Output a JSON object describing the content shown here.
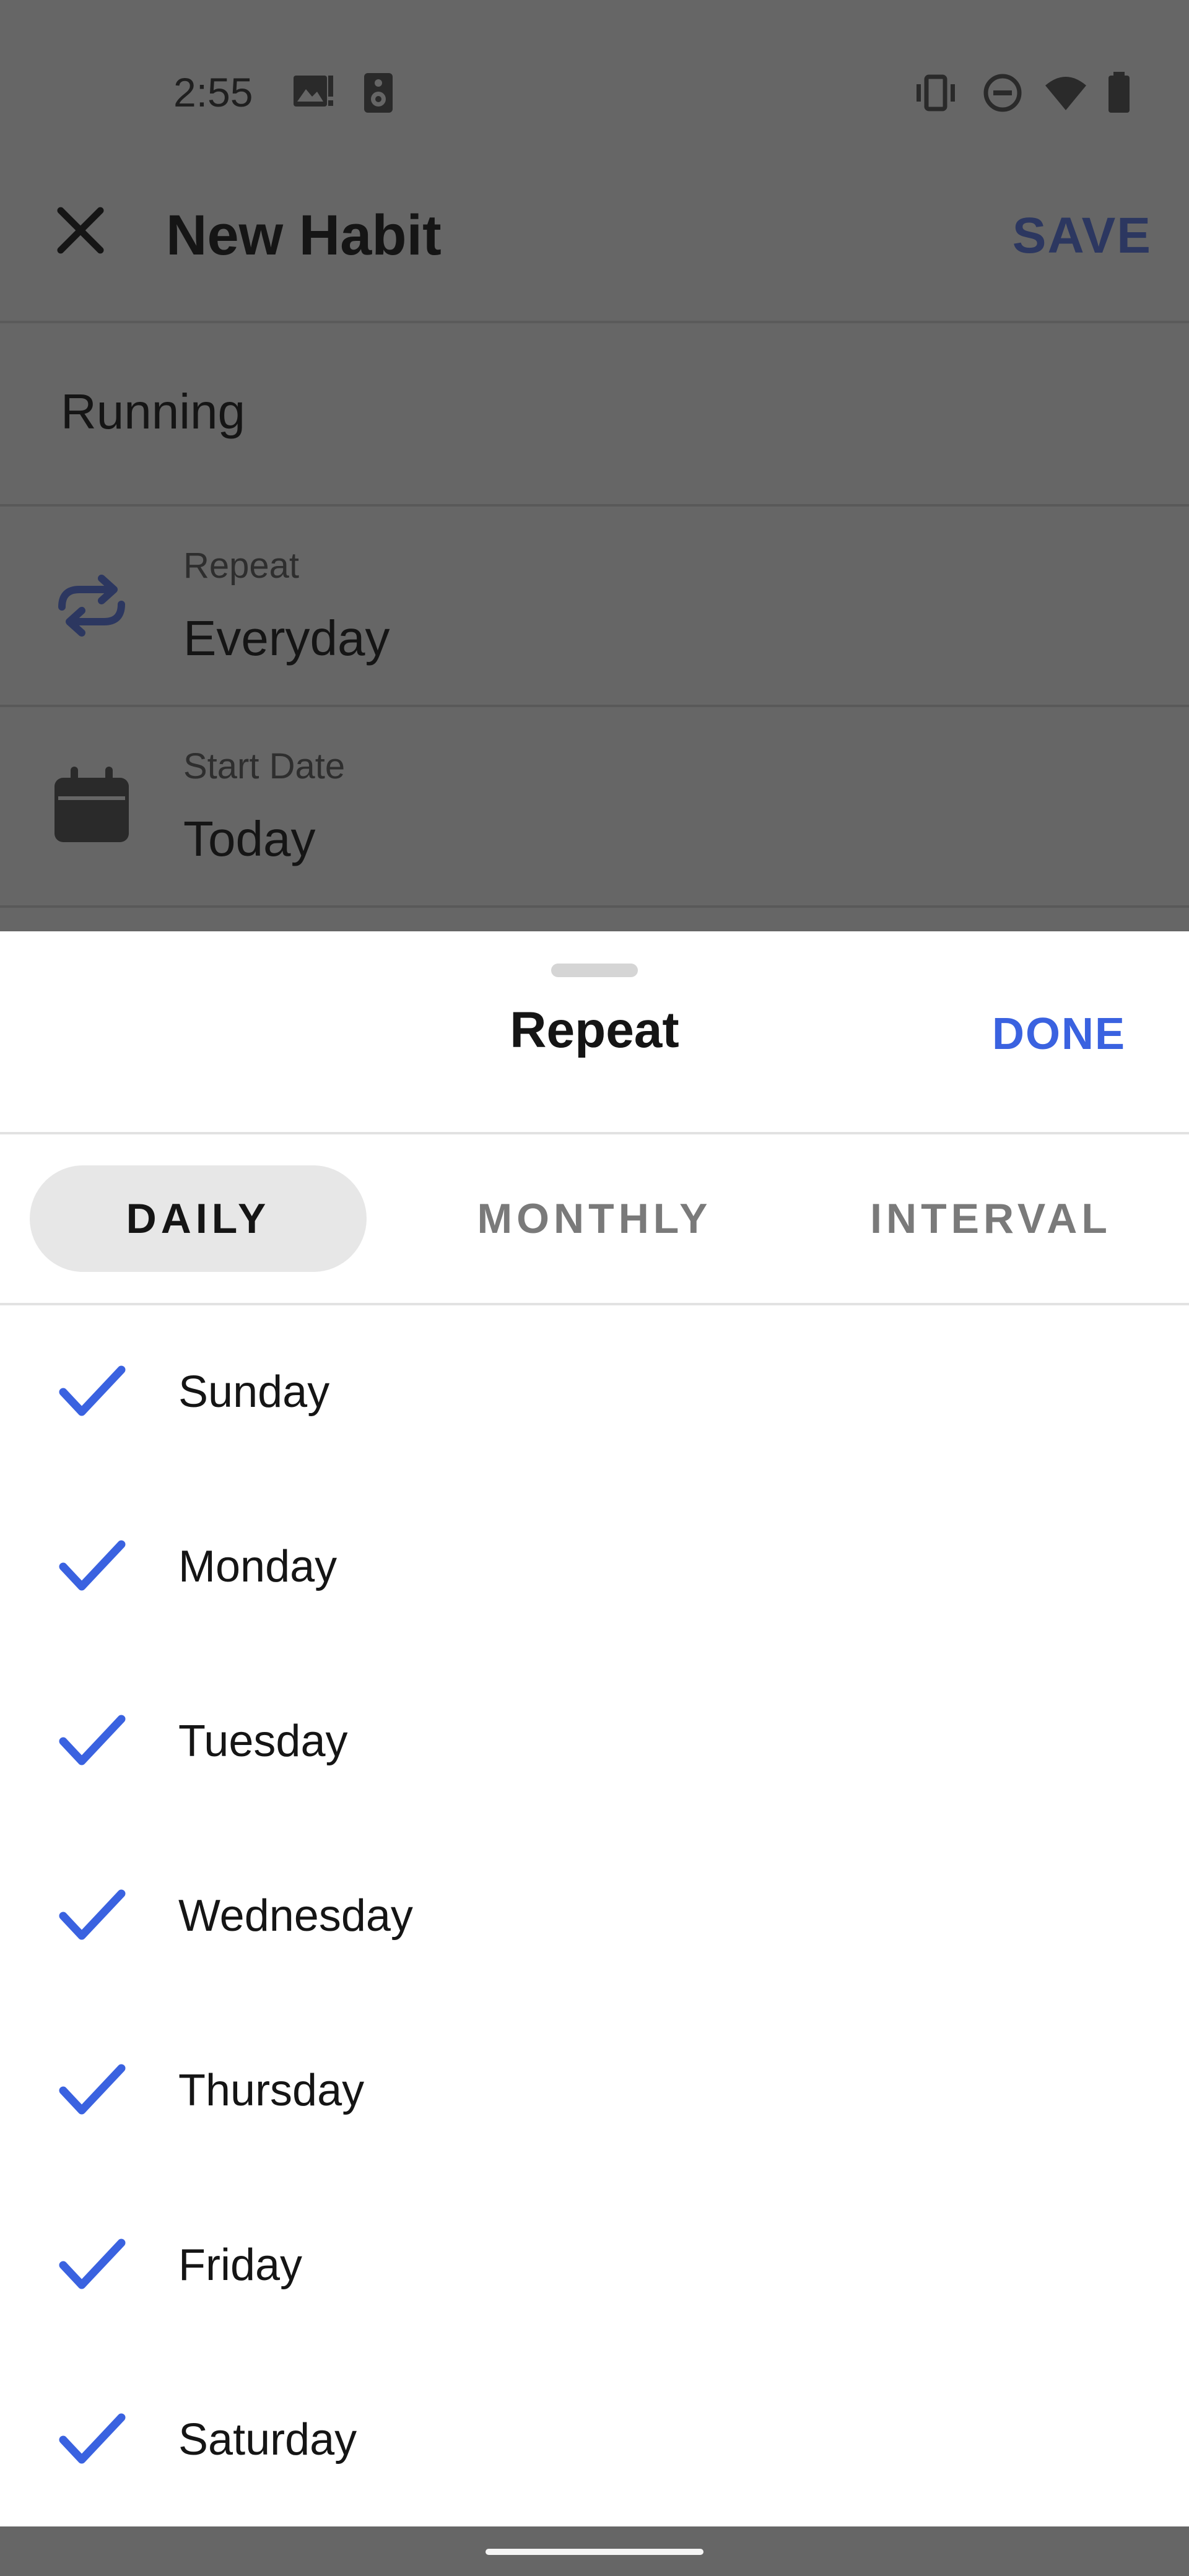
{
  "status_bar": {
    "time": "2:55",
    "left_icons": [
      "image-alert-icon",
      "speaker-icon"
    ],
    "right_icons": [
      "vibrate-icon",
      "do-not-disturb-icon",
      "wifi-icon",
      "battery-icon"
    ]
  },
  "app_bar": {
    "close_icon": "close-icon",
    "title": "New Habit",
    "save_label": "SAVE"
  },
  "habit": {
    "name_value": "Running"
  },
  "repeat_row": {
    "icon": "repeat-icon",
    "label": "Repeat",
    "value": "Everyday"
  },
  "start_date_row": {
    "icon": "calendar-icon",
    "label": "Start Date",
    "value": "Today"
  },
  "sheet": {
    "title": "Repeat",
    "done_label": "DONE",
    "tabs": [
      {
        "label": "DAILY",
        "selected": true
      },
      {
        "label": "MONTHLY",
        "selected": false
      },
      {
        "label": "INTERVAL",
        "selected": false
      }
    ],
    "days": [
      {
        "label": "Sunday",
        "checked": true
      },
      {
        "label": "Monday",
        "checked": true
      },
      {
        "label": "Tuesday",
        "checked": true
      },
      {
        "label": "Wednesday",
        "checked": true
      },
      {
        "label": "Thursday",
        "checked": true
      },
      {
        "label": "Friday",
        "checked": true
      },
      {
        "label": "Saturday",
        "checked": true
      }
    ]
  },
  "colors": {
    "accent": "#3a62e0",
    "scrim": "#666666",
    "selected_tab_bg": "#e7e7e7"
  }
}
